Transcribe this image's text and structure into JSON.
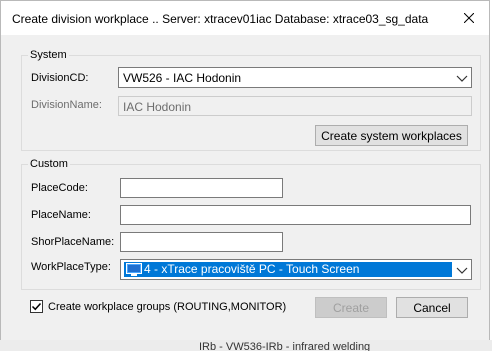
{
  "window": {
    "title": "Create division workplace .. Server: xtracev01iac    Database: xtrace03_sg_data",
    "close_icon": "close-icon"
  },
  "system_group": {
    "legend": "System",
    "division_cd_label": "DivisionCD:",
    "division_cd_value": "VW526 - IAC Hodonin",
    "division_name_label": "DivisionName:",
    "division_name_value": "IAC Hodonin",
    "create_system_workplaces_label": "Create system workplaces"
  },
  "custom_group": {
    "legend": "Custom",
    "place_code_label": "PlaceCode:",
    "place_code_value": "",
    "place_name_label": "PlaceName:",
    "place_name_value": "",
    "short_place_name_label": "ShorPlaceName:",
    "short_place_name_value": "",
    "workplace_type_label": "WorkPlaceType:",
    "workplace_type_value": "4 - xTrace pracoviště PC - Touch Screen",
    "workplace_type_icon": "monitor-icon"
  },
  "footer": {
    "groups_checkbox_label": "Create workplace groups (ROUTING,MONITOR)",
    "groups_checkbox_checked": true,
    "create_label": "Create",
    "cancel_label": "Cancel"
  },
  "background": {
    "partial_text": "IRb - VW536-IRb - infrared welding"
  },
  "colors": {
    "selection": "#0078d7",
    "dialog_bg": "#f0f0f0"
  }
}
